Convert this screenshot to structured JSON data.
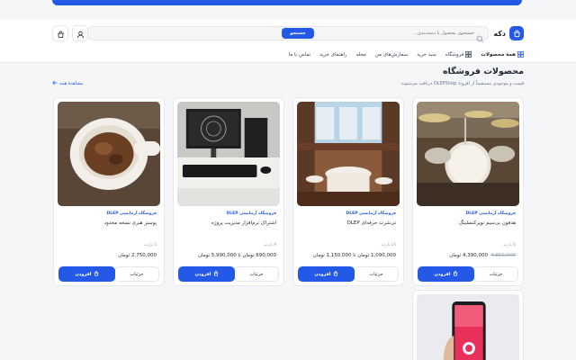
{
  "brand": {
    "name": "دکه"
  },
  "search": {
    "placeholder": "جستجوی محصول یا دسته‌بندی...",
    "button_label": "جستجو"
  },
  "nav": {
    "items": [
      {
        "label": "همهٔ محصولات",
        "icon": "grid-icon"
      },
      {
        "label": "فروشگاه",
        "icon": "store-icon"
      },
      {
        "label": "سبد خرید"
      },
      {
        "label": "سفارش‌های من"
      },
      {
        "label": "مجله"
      },
      {
        "label": "راهنمای خرید"
      },
      {
        "label": "تماس با ما"
      }
    ]
  },
  "page": {
    "title": "محصولات فروشگاه",
    "subtitle": "قیمت و موجودی مستقیماً از افزونهٔ DLEPShop دریافت می‌شوند.",
    "view_all": "مشاهدهٔ همه"
  },
  "card_labels": {
    "details": "جزئیات",
    "add": "افزودن"
  },
  "products": [
    {
      "vendor": "فروشگاه آزمایشی DLEP",
      "name": "هدفون بی‌سیم نویزکنسلینگ",
      "sold": "6 بازدید",
      "price": "4,390,000 تومان",
      "old_price": "4,850,000",
      "image": "drums"
    },
    {
      "vendor": "فروشگاه آزمایشی DLEP",
      "name": "تی‌شرت حرفه‌ای DLEP",
      "sold": "14 بازدید",
      "price": "1,090,000 تومان تا 1,150,000 تومان",
      "old_price": "",
      "image": "restaurant"
    },
    {
      "vendor": "فروشگاه آزمایشی DLEP",
      "name": "اشتراک نرم‌افزار مدیریت پروژه",
      "sold": "9 بازدید",
      "price": "690,000 تومان تا 5,990,000 تومان",
      "old_price": "",
      "image": "computer"
    },
    {
      "vendor": "فروشگاه آزمایشی DLEP",
      "name": "پوستر هنری نسخه محدود",
      "sold": "5 بازدید",
      "price": "2,750,000 تومان",
      "old_price": "",
      "image": "coffee"
    },
    {
      "vendor": "",
      "name": "",
      "sold": "",
      "price": "",
      "old_price": "",
      "image": "phone"
    }
  ]
}
